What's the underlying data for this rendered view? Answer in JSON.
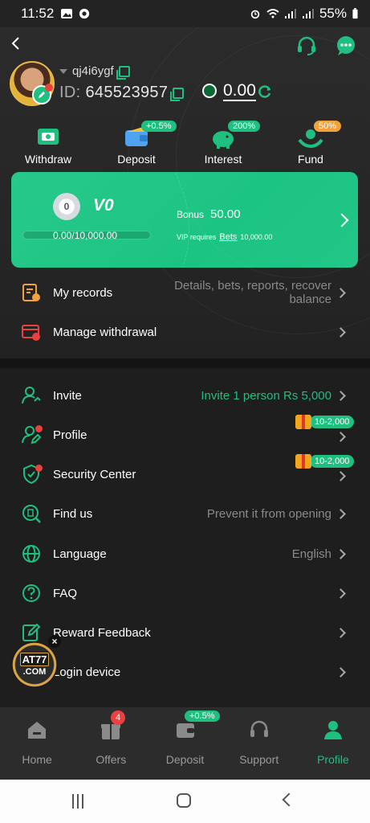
{
  "status_bar": {
    "time": "11:52",
    "battery": "55%"
  },
  "header": {
    "username": "qj4i6ygf",
    "id_label": "ID:",
    "id_value": "645523957",
    "balance": "0.00"
  },
  "actions": [
    {
      "label": "Withdraw",
      "badge": ""
    },
    {
      "label": "Deposit",
      "badge": "+0.5%"
    },
    {
      "label": "Interest",
      "badge": "200%"
    },
    {
      "label": "Fund",
      "badge": "50%"
    }
  ],
  "vip": {
    "medal": "0",
    "level": "V0",
    "progress_text": "0.00/10,000.00",
    "progress_fraction": 0,
    "bonus_label": "Bonus",
    "bonus_value": "50.00",
    "requires_label": "VIP requires",
    "requires_link": "Bets",
    "requires_value": "10,000.00"
  },
  "records": {
    "label": "My records",
    "value": "Details, bets, reports, recover balance"
  },
  "manage_withdrawal": {
    "label": "Manage withdrawal"
  },
  "menu": {
    "invite": {
      "label": "Invite",
      "value": "Invite 1 person Rs 5,000"
    },
    "profile": {
      "label": "Profile",
      "gift": "10-2,000"
    },
    "security": {
      "label": "Security Center",
      "gift": "10-2,000"
    },
    "findus": {
      "label": "Find us",
      "value": "Prevent it from opening"
    },
    "language": {
      "label": "Language",
      "value": "English"
    },
    "faq": {
      "label": "FAQ"
    },
    "feedback": {
      "label": "Reward Feedback"
    },
    "login_device": {
      "label": "Login device"
    }
  },
  "promo": {
    "line1": "AT77",
    "line2": ".COM",
    "close": "×"
  },
  "bottom_nav": [
    {
      "label": "Home"
    },
    {
      "label": "Offers",
      "badge": "4"
    },
    {
      "label": "Deposit",
      "badge": "+0.5%"
    },
    {
      "label": "Support"
    },
    {
      "label": "Profile"
    }
  ],
  "colors": {
    "accent": "#1fbf7f",
    "background": "#1e1e1e",
    "alert": "#e8413f",
    "orange": "#f3a13b"
  }
}
